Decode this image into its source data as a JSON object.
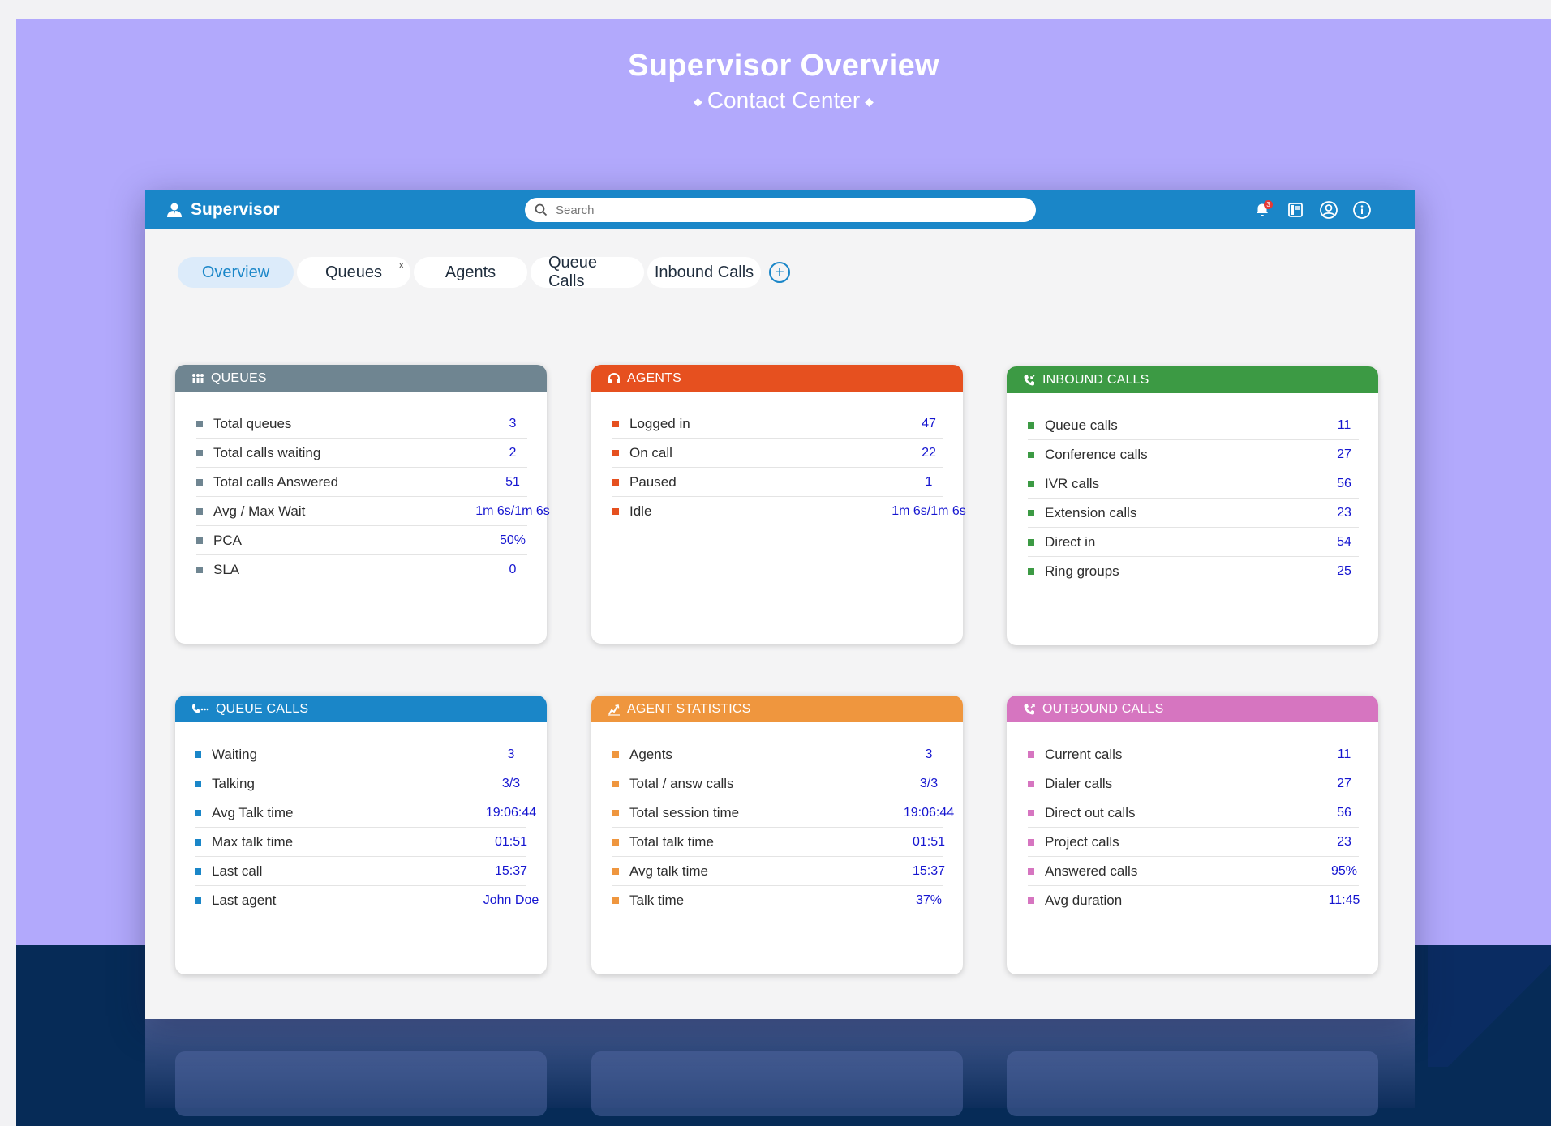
{
  "hero": {
    "title": "Supervisor Overview",
    "subtitle": "Contact Center"
  },
  "topbar": {
    "brand": "Supervisor",
    "search_placeholder": "Search",
    "notification_count": "3"
  },
  "tabs": [
    {
      "label": "Overview",
      "active": true
    },
    {
      "label": "Queues",
      "closable": true
    },
    {
      "label": "Agents"
    },
    {
      "label": "Queue Calls"
    },
    {
      "label": "Inbound Calls"
    }
  ],
  "tab_add_label": "+",
  "tab_close_label": "x",
  "cards": {
    "queues": {
      "title": "QUEUES",
      "color": "#6f8591",
      "rows": [
        {
          "label": "Total queues",
          "value": "3"
        },
        {
          "label": "Total calls waiting",
          "value": "2"
        },
        {
          "label": "Total calls Answered",
          "value": "51"
        },
        {
          "label": "Avg / Max Wait",
          "value": "1m 6s/1m 6s"
        },
        {
          "label": "PCA",
          "value": "50%"
        },
        {
          "label": "SLA",
          "value": "0"
        }
      ]
    },
    "agents": {
      "title": "AGENTS",
      "color": "#e6501f",
      "rows": [
        {
          "label": "Logged in",
          "value": "47"
        },
        {
          "label": "On call",
          "value": "22"
        },
        {
          "label": "Paused",
          "value": "1"
        },
        {
          "label": "Idle",
          "value": "1m 6s/1m 6s"
        }
      ]
    },
    "inbound": {
      "title": "INBOUND CALLS",
      "color": "#3c9a44",
      "rows": [
        {
          "label": "Queue calls",
          "value": "11"
        },
        {
          "label": "Conference calls",
          "value": "27"
        },
        {
          "label": "IVR calls",
          "value": "56"
        },
        {
          "label": "Extension calls",
          "value": "23"
        },
        {
          "label": "Direct in",
          "value": "54"
        },
        {
          "label": "Ring groups",
          "value": "25"
        }
      ]
    },
    "queue_calls": {
      "title": "QUEUE CALLS",
      "color": "#1a86c8",
      "rows": [
        {
          "label": "Waiting",
          "value": "3"
        },
        {
          "label": "Talking",
          "value": "3/3"
        },
        {
          "label": "Avg Talk time",
          "value": "19:06:44"
        },
        {
          "label": "Max talk time",
          "value": "01:51"
        },
        {
          "label": "Last call",
          "value": "15:37"
        },
        {
          "label": "Last agent",
          "value": "John Doe"
        }
      ]
    },
    "agent_stats": {
      "title": "AGENT STATISTICS",
      "color": "#ef963e",
      "rows": [
        {
          "label": "Agents",
          "value": "3"
        },
        {
          "label": "Total / answ calls",
          "value": "3/3"
        },
        {
          "label": "Total session time",
          "value": "19:06:44"
        },
        {
          "label": "Total talk time",
          "value": "01:51"
        },
        {
          "label": "Avg talk time",
          "value": "15:37"
        },
        {
          "label": "Talk time",
          "value": "37%"
        }
      ]
    },
    "outbound": {
      "title": "OUTBOUND CALLS",
      "color": "#d675c0",
      "rows": [
        {
          "label": "Current calls",
          "value": "11"
        },
        {
          "label": "Dialer calls",
          "value": "27"
        },
        {
          "label": "Direct out calls",
          "value": "56"
        },
        {
          "label": "Project calls",
          "value": "23"
        },
        {
          "label": "Answered calls",
          "value": "95%"
        },
        {
          "label": "Avg duration",
          "value": "11:45"
        }
      ]
    }
  }
}
